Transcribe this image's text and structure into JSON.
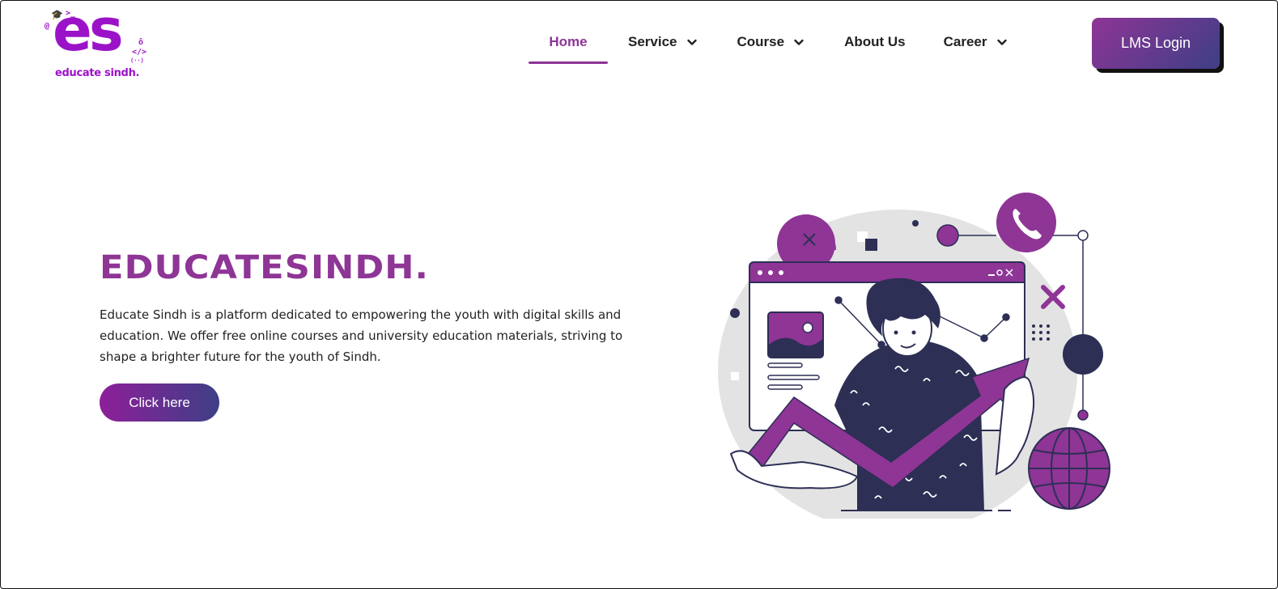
{
  "brand": {
    "logo_mark": "es",
    "logo_text": "educate sindh."
  },
  "nav": {
    "items": [
      {
        "label": "Home",
        "active": true,
        "has_dropdown": false
      },
      {
        "label": "Service",
        "active": false,
        "has_dropdown": true
      },
      {
        "label": "Course",
        "active": false,
        "has_dropdown": true
      },
      {
        "label": "About Us",
        "active": false,
        "has_dropdown": false
      },
      {
        "label": "Career",
        "active": false,
        "has_dropdown": true
      }
    ],
    "login_label": "LMS Login"
  },
  "hero": {
    "title": "EDUCATESINDH.",
    "description": "Educate Sindh is a platform dedicated to empowering the youth with digital skills and education. We offer free online courses and university education materials, striving to shape a brighter future for the youth of Sindh.",
    "cta_label": "Click here"
  },
  "colors": {
    "brand_purple": "#8e3596",
    "logo_purple": "#9b13c9",
    "navy": "#2d2f55",
    "light_gray": "#e3e3e3"
  },
  "icons": [
    "chevron-down-icon",
    "phone-icon",
    "globe-icon",
    "close-icon",
    "image-icon"
  ]
}
